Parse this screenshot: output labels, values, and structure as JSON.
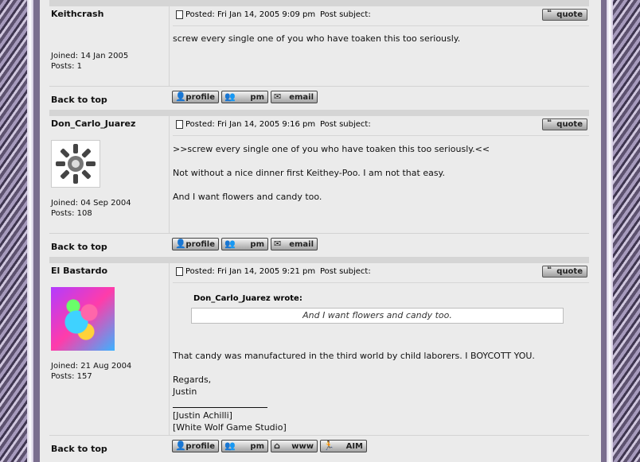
{
  "post_action_labels": {
    "quote": "quote",
    "back_to_top": "Back to top",
    "profile": "profile",
    "pm": "pm",
    "email": "email",
    "www": "www",
    "aim": "AIM",
    "subject": "Post subject:"
  },
  "posts": [
    {
      "author": "Keithcrash",
      "joined": "Joined: 14 Jan 2005",
      "posts": "Posts: 1",
      "posted": "Posted: Fri Jan 14, 2005 9:09 pm",
      "lines": [
        "screw every single one of you who have toaken this too seriously."
      ]
    },
    {
      "author": "Don_Carlo_Juarez",
      "joined": "Joined: 04 Sep 2004",
      "posts": "Posts: 108",
      "posted": "Posted: Fri Jan 14, 2005 9:16 pm",
      "lines": [
        ">>screw every single one of you who have toaken this too seriously.<<",
        "Not without a nice dinner first Keithey-Poo. I am not that easy.",
        "And I want flowers and candy too."
      ]
    },
    {
      "author": "El Bastardo",
      "joined": "Joined: 21 Aug 2004",
      "posts": "Posts: 157",
      "posted": "Posted: Fri Jan 14, 2005 9:21 pm",
      "quote_author": "Don_Carlo_Juarez wrote:",
      "quote_text": "And I want flowers and candy too.",
      "lines": [
        "That candy was manufactured in the third world by child laborers. I BOYCOTT YOU.",
        "Regards,",
        "Justin",
        "[Justin Achilli]",
        "[White Wolf Game Studio]"
      ]
    }
  ]
}
